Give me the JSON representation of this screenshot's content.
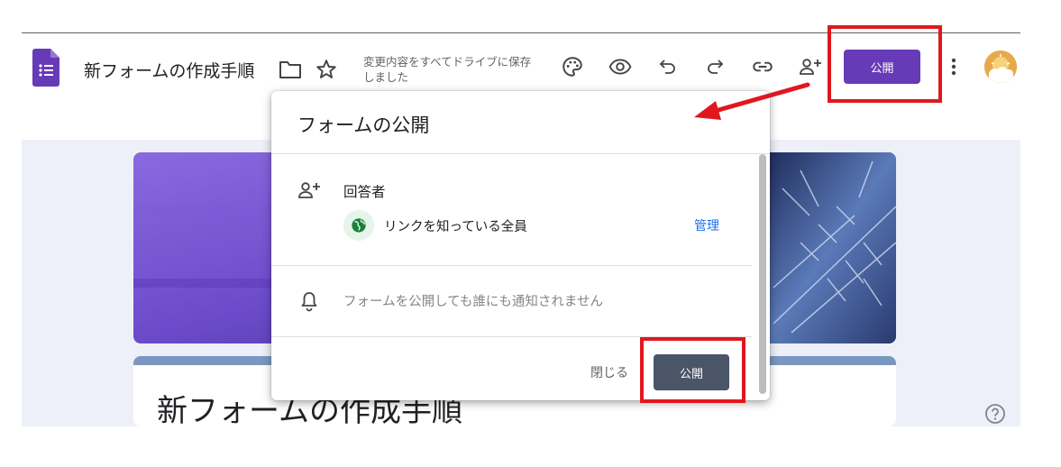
{
  "header": {
    "document_title": "新フォームの作成手順",
    "save_status": "変更内容をすべてドライブに保存しました",
    "publish_label": "公開",
    "icons": [
      "forms-logo-icon",
      "folder-icon",
      "star-icon",
      "palette-icon",
      "preview-eye-icon",
      "undo-icon",
      "redo-icon",
      "link-icon",
      "add-collaborator-icon",
      "more-vert-icon"
    ]
  },
  "form": {
    "title": "新フォームの作成手順"
  },
  "dialog": {
    "title": "フォームの公開",
    "respondents": {
      "label": "回答者",
      "access": "リンクを知っている全員",
      "manage_label": "管理"
    },
    "notification": "フォームを公開しても誰にも通知されません",
    "close_label": "閉じる",
    "publish_label": "公開"
  },
  "colors": {
    "accent": "#673ab7",
    "publish_dialog_button": "#4a5568",
    "annotation_red": "#e0181e",
    "link_blue": "#1a73e8"
  }
}
